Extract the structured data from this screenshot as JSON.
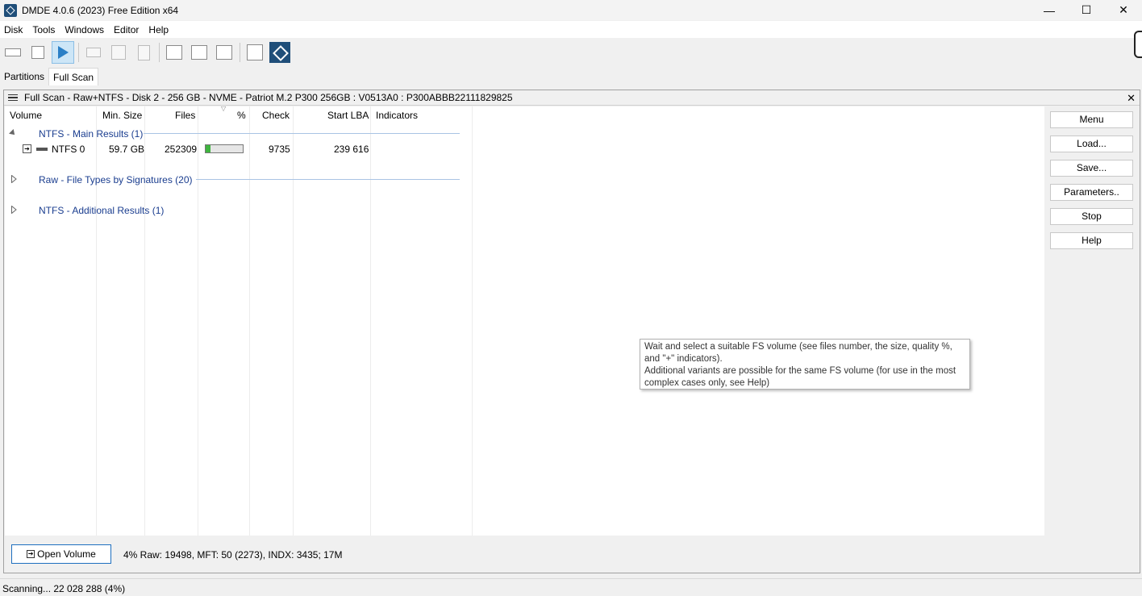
{
  "window": {
    "title": "DMDE 4.0.6 (2023) Free Edition x64",
    "minimize": "—",
    "maximize": "☐",
    "close": "✕"
  },
  "menubar": [
    "Disk",
    "Tools",
    "Windows",
    "Editor",
    "Help"
  ],
  "tabs": [
    "Partitions",
    "Full Scan"
  ],
  "active_tab": "Full Scan",
  "panel": {
    "title": "Full Scan - Raw+NTFS - Disk 2 - 256 GB - NVME - Patriot M.2 P300 256GB : V0513A0 : P300ABBB22111829825",
    "close": "✕"
  },
  "columns": [
    "Volume",
    "Min. Size",
    "Files",
    "%",
    "Check",
    "Start LBA",
    "Indicators"
  ],
  "groups": [
    {
      "label": "NTFS - Main Results (1)",
      "expanded": true
    },
    {
      "label": "Raw - File Types by Signatures (20)",
      "expanded": false
    },
    {
      "label": "NTFS - Additional Results (1)",
      "expanded": false
    }
  ],
  "rows": [
    {
      "volume": "NTFS 0",
      "min_size": "59.7 GB",
      "files": "252309",
      "percent": 0.12,
      "check": "9735",
      "start_lba": "239 616",
      "indicators": ""
    }
  ],
  "side_buttons": [
    "Menu",
    "Load...",
    "Save...",
    "Parameters..",
    "Stop",
    "Help"
  ],
  "tooltip": {
    "line1": "Wait and select a suitable FS volume (see files number, the size, quality %,",
    "line2": "and \"+\" indicators).",
    "line3": "Additional variants are possible for the same FS volume (for use in the most",
    "line4": "complex cases only, see Help)"
  },
  "bottom": {
    "open_button": "Open Volume",
    "scan_info": "4% Raw: 19498, MFT: 50 (2273), INDX: 3435; 17M"
  },
  "status": "Scanning... 22 028 288 (4%)",
  "colors": {
    "progress": "#3fb43f",
    "group_text": "#1a3d8f",
    "active_tool": "#cde6f7"
  }
}
